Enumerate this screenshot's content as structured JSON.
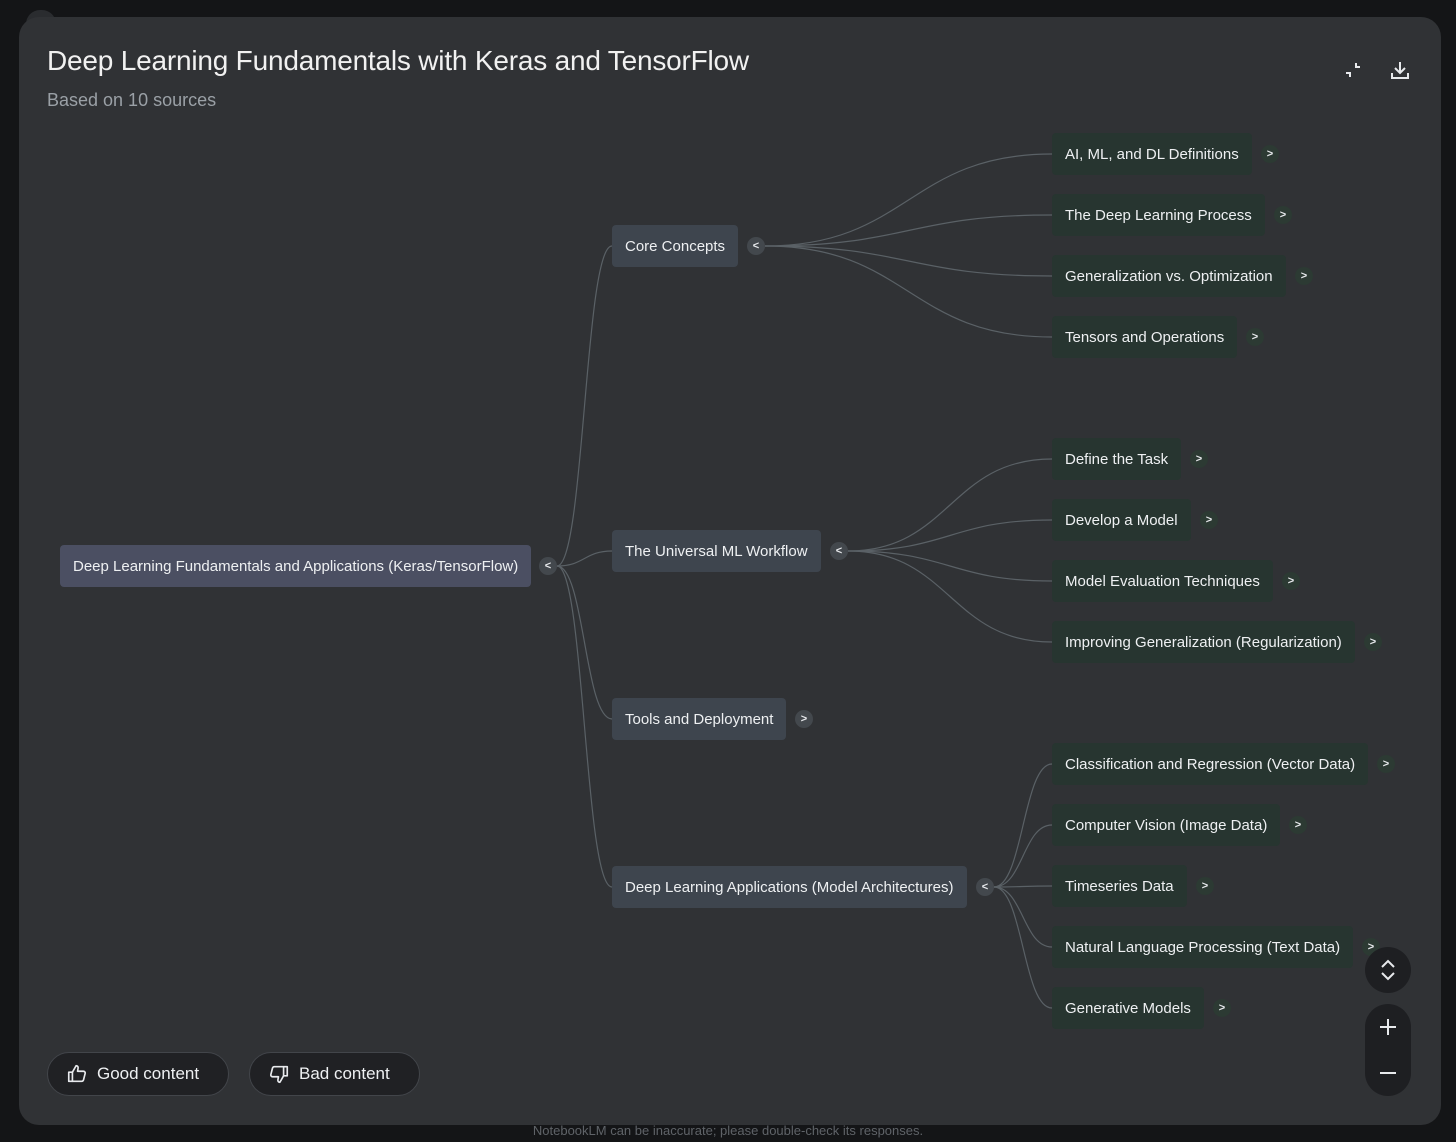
{
  "header": {
    "title": "Deep Learning Fundamentals with Keras and TensorFlow",
    "subtitle": "Based on 10 sources",
    "collapse_icon": "collapse-icon",
    "download_icon": "download-icon"
  },
  "mindmap": {
    "root": {
      "label": "Deep Learning Fundamentals and Applications (Keras/TensorFlow)",
      "toggle": "<"
    },
    "branches": [
      {
        "label": "Core Concepts",
        "toggle": "<",
        "children": [
          {
            "label": "AI, ML, and DL Definitions",
            "toggle": ">"
          },
          {
            "label": "The Deep Learning Process",
            "toggle": ">"
          },
          {
            "label": "Generalization vs. Optimization",
            "toggle": ">"
          },
          {
            "label": "Tensors and Operations",
            "toggle": ">"
          }
        ]
      },
      {
        "label": "The Universal ML Workflow",
        "toggle": "<",
        "children": [
          {
            "label": "Define the Task",
            "toggle": ">"
          },
          {
            "label": "Develop a Model",
            "toggle": ">"
          },
          {
            "label": "Model Evaluation Techniques",
            "toggle": ">"
          },
          {
            "label": "Improving Generalization (Regularization)",
            "toggle": ">"
          }
        ]
      },
      {
        "label": "Tools and Deployment",
        "toggle": ">",
        "children": []
      },
      {
        "label": "Deep Learning Applications (Model Architectures)",
        "toggle": "<",
        "children": [
          {
            "label": "Classification and Regression (Vector Data)",
            "toggle": ">"
          },
          {
            "label": "Computer Vision (Image Data)",
            "toggle": ">"
          },
          {
            "label": "Timeseries Data",
            "toggle": ">"
          },
          {
            "label": "Natural Language Processing (Text Data)",
            "toggle": ">"
          },
          {
            "label": "Generative Models",
            "toggle": ">"
          }
        ]
      }
    ]
  },
  "feedback": {
    "good_label": "Good content",
    "bad_label": "Bad content",
    "good_icon": "thumbs-up-icon",
    "bad_icon": "thumbs-down-icon"
  },
  "controls": {
    "expand_collapse_icon": "expand-collapse-icon",
    "zoom_in_icon": "plus-icon",
    "zoom_out_icon": "minus-icon"
  },
  "footer": {
    "disclaimer": "NotebookLM can be inaccurate; please double-check its responses."
  },
  "colors": {
    "panel_bg": "#303235",
    "root_node": "#4b4f62",
    "branch_node": "#3e454e",
    "leaf_node": "#273530",
    "link": "#5a6166"
  }
}
